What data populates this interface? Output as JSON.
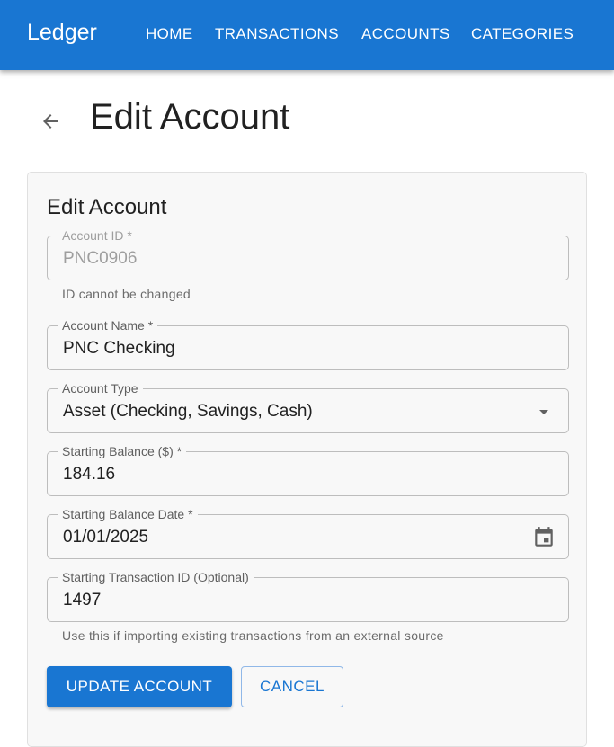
{
  "appbar": {
    "brand": "Ledger",
    "nav": [
      "HOME",
      "TRANSACTIONS",
      "ACCOUNTS",
      "CATEGORIES"
    ]
  },
  "page": {
    "title": "Edit Account",
    "back_icon": "arrow-left-icon"
  },
  "form": {
    "title": "Edit Account",
    "account_id": {
      "label": "Account ID *",
      "value": "PNC0906",
      "helper": "ID cannot be changed"
    },
    "account_name": {
      "label": "Account Name *",
      "value": "PNC Checking"
    },
    "account_type": {
      "label": "Account Type",
      "value": "Asset (Checking, Savings, Cash)",
      "icon": "dropdown-arrow-icon"
    },
    "starting_balance": {
      "label": "Starting Balance ($) *",
      "value": "184.16"
    },
    "starting_balance_date": {
      "label": "Starting Balance Date *",
      "value": "01/01/2025",
      "icon": "calendar-icon"
    },
    "starting_transaction_id": {
      "label": "Starting Transaction ID (Optional)",
      "value": "1497",
      "helper": "Use this if importing existing transactions from an external source"
    },
    "update_label": "UPDATE ACCOUNT",
    "cancel_label": "CANCEL"
  },
  "colors": {
    "primary": "#1976d2",
    "card_background": "#f8f8f8"
  }
}
